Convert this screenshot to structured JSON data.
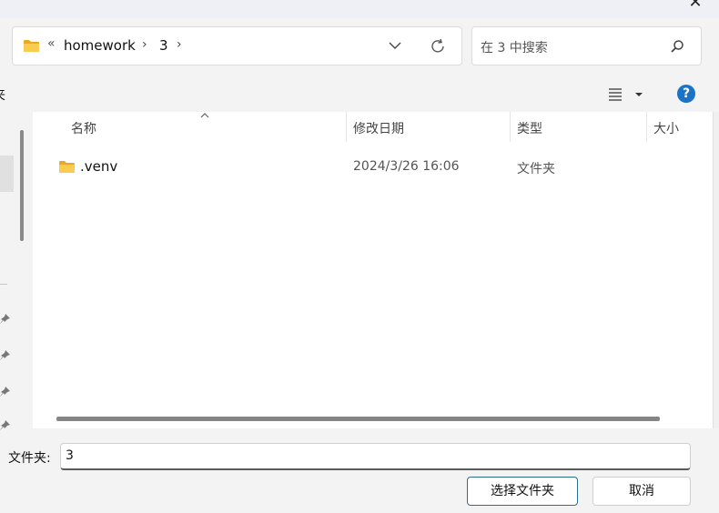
{
  "window": {
    "close_glyph": "✕"
  },
  "address": {
    "overflow_glyph": "«",
    "crumbs": [
      "homework",
      "3"
    ],
    "separator": "›"
  },
  "search": {
    "placeholder": "在 3 中搜索"
  },
  "toolbar": {
    "partial_label": "夹",
    "help_glyph": "?"
  },
  "columns": {
    "name": "名称",
    "modified": "修改日期",
    "type": "类型",
    "size": "大小"
  },
  "files": [
    {
      "name": ".venv",
      "modified": "2024/3/26 16:06",
      "type": "文件夹"
    }
  ],
  "footer": {
    "folder_label": "文件夹:",
    "folder_value": "3",
    "select_button": "选择文件夹",
    "cancel_button": "取消"
  },
  "colors": {
    "folder": "#f4c542",
    "accent": "#1a73c6",
    "primary_border": "#2b6e8e"
  },
  "icons": [
    "folder-icon",
    "chevron-down-icon",
    "refresh-icon",
    "search-icon",
    "list-view-icon",
    "help-icon",
    "pin-icon",
    "close-icon"
  ]
}
